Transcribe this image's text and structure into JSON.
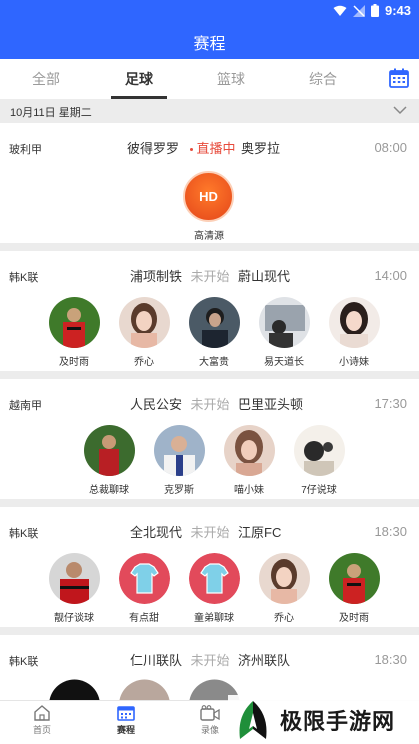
{
  "status_bar": {
    "time": "9:43"
  },
  "header": {
    "title": "赛程"
  },
  "tabs": [
    {
      "label": "全部"
    },
    {
      "label": "足球"
    },
    {
      "label": "篮球"
    },
    {
      "label": "综合"
    }
  ],
  "date_bar": {
    "text": "10月11日 星期二"
  },
  "matches": [
    {
      "league": "玻利甲",
      "home": "彼得罗罗",
      "status": "直播中",
      "away": "奥罗拉",
      "time": "08:00",
      "hd": {
        "badge": "HD",
        "label": "高清源"
      }
    },
    {
      "league": "韩K联",
      "home": "浦项制铁",
      "status": "未开始",
      "away": "蔚山现代",
      "time": "14:00",
      "streamers": [
        "及时雨",
        "乔心",
        "大富贵",
        "易天道长",
        "小诗妹"
      ]
    },
    {
      "league": "越南甲",
      "home": "人民公安",
      "status": "未开始",
      "away": "巴里亚头顿",
      "time": "17:30",
      "streamers": [
        "总裁聊球",
        "克罗斯",
        "喵小妹",
        "7仔说球"
      ]
    },
    {
      "league": "韩K联",
      "home": "全北现代",
      "status": "未开始",
      "away": "江原FC",
      "time": "18:30",
      "streamers": [
        "靓仔谈球",
        "有点甜",
        "童弟聊球",
        "乔心",
        "及时雨"
      ]
    },
    {
      "league": "韩K联",
      "home": "仁川联队",
      "status": "未开始",
      "away": "济州联队",
      "time": "18:30"
    }
  ],
  "bottom_nav": [
    {
      "label": "首页"
    },
    {
      "label": "赛程"
    },
    {
      "label": "录像"
    }
  ],
  "watermark": {
    "text": "极限手游网"
  },
  "colors": {
    "primary": "#2f66ff",
    "live": "#e74b3c",
    "hd": "#ff6a22"
  }
}
